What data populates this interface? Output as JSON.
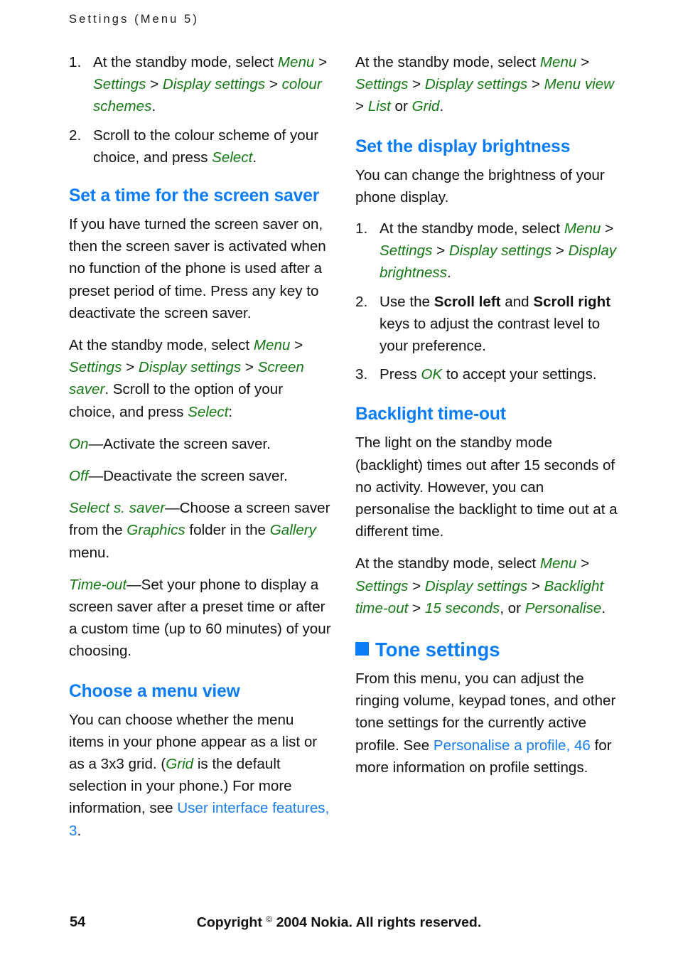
{
  "page": {
    "running_head": "Settings (Menu 5)",
    "folio": "54",
    "copyright_prefix": "Copyright ",
    "copyright_mark": "©",
    "copyright_suffix": " 2004 Nokia. All rights reserved."
  },
  "colors": {
    "heading_blue": "#0b7cf7",
    "link_blue": "#1a7ef0",
    "ui_green": "#157a15",
    "body_black": "#121212",
    "page_background": "#ffffff"
  },
  "left_column": {
    "colour_scheme_steps": [
      {
        "number": "1.",
        "parts": [
          {
            "type": "text",
            "text": "At the standby mode, select "
          },
          {
            "type": "ui",
            "text": "Menu"
          },
          {
            "type": "text",
            "text": " > "
          },
          {
            "type": "ui",
            "text": "Settings"
          },
          {
            "type": "text",
            "text": " > "
          },
          {
            "type": "ui",
            "text": "Display settings"
          },
          {
            "type": "text",
            "text": " > "
          },
          {
            "type": "ui",
            "text": "colour schemes"
          },
          {
            "type": "text",
            "text": "."
          }
        ]
      },
      {
        "number": "2.",
        "parts": [
          {
            "type": "text",
            "text": "Scroll to the colour scheme of your choice, and press "
          },
          {
            "type": "ui",
            "text": "Select"
          },
          {
            "type": "text",
            "text": "."
          }
        ]
      }
    ],
    "screen_saver_heading": "Set a time for the screen saver",
    "screen_saver_intro": "If you have turned the screen saver on, then the screen saver is activated when no function of the phone is used after a preset period of time. Press any key to deactivate the screen saver.",
    "screen_saver_path": [
      {
        "type": "text",
        "text": "At the standby mode, select "
      },
      {
        "type": "ui",
        "text": "Menu"
      },
      {
        "type": "text",
        "text": " > "
      },
      {
        "type": "ui",
        "text": "Settings"
      },
      {
        "type": "text",
        "text": " > "
      },
      {
        "type": "ui",
        "text": "Display settings"
      },
      {
        "type": "text",
        "text": " > "
      },
      {
        "type": "ui",
        "text": "Screen saver"
      },
      {
        "type": "text",
        "text": ". Scroll to the option of your choice, and press "
      },
      {
        "type": "ui",
        "text": "Select"
      },
      {
        "type": "text",
        "text": ":"
      }
    ],
    "option_on": [
      {
        "type": "ui",
        "text": "On"
      },
      {
        "type": "text",
        "text": "—Activate the screen saver."
      }
    ],
    "option_off": [
      {
        "type": "ui",
        "text": "Off"
      },
      {
        "type": "text",
        "text": "—Deactivate the screen saver."
      }
    ],
    "option_select_s_saver": [
      {
        "type": "ui",
        "text": "Select s. saver"
      },
      {
        "type": "text",
        "text": "—Choose a screen saver from the "
      },
      {
        "type": "ui",
        "text": "Graphics"
      },
      {
        "type": "text",
        "text": " folder in the "
      },
      {
        "type": "ui",
        "text": "Gallery"
      },
      {
        "type": "text",
        "text": " menu."
      }
    ],
    "option_time_out": [
      {
        "type": "ui",
        "text": "Time-out"
      },
      {
        "type": "text",
        "text": "—Set your phone to display a screen saver after a preset time or after a custom time (up to 60 minutes) of your choosing."
      }
    ],
    "menu_view_heading": "Choose a menu view",
    "menu_view_body": [
      {
        "type": "text",
        "text": "You can choose whether the menu items in your phone appear as a list or as a 3x3 grid. ("
      },
      {
        "type": "ui",
        "text": "Grid"
      },
      {
        "type": "text",
        "text": " is the default selection in your phone.) For more information, see "
      },
      {
        "type": "link",
        "text": "User interface features, 3"
      },
      {
        "type": "text",
        "text": "."
      }
    ]
  },
  "right_column": {
    "menu_view_path": [
      {
        "type": "text",
        "text": "At the standby mode, select "
      },
      {
        "type": "ui",
        "text": "Menu"
      },
      {
        "type": "text",
        "text": " > "
      },
      {
        "type": "ui",
        "text": "Settings"
      },
      {
        "type": "text",
        "text": " > "
      },
      {
        "type": "ui",
        "text": "Display settings"
      },
      {
        "type": "text",
        "text": " > "
      },
      {
        "type": "ui",
        "text": "Menu view"
      },
      {
        "type": "text",
        "text": " > "
      },
      {
        "type": "ui",
        "text": "List"
      },
      {
        "type": "text",
        "text": " or "
      },
      {
        "type": "ui",
        "text": "Grid"
      },
      {
        "type": "text",
        "text": "."
      }
    ],
    "brightness_heading": "Set the display brightness",
    "brightness_intro": "You can change the brightness of your phone display.",
    "brightness_steps": [
      {
        "number": "1.",
        "parts": [
          {
            "type": "text",
            "text": "At the standby mode, select "
          },
          {
            "type": "ui",
            "text": "Menu"
          },
          {
            "type": "text",
            "text": " > "
          },
          {
            "type": "ui",
            "text": "Settings"
          },
          {
            "type": "text",
            "text": " > "
          },
          {
            "type": "ui",
            "text": "Display settings"
          },
          {
            "type": "text",
            "text": " > "
          },
          {
            "type": "ui",
            "text": "Display brightness"
          },
          {
            "type": "text",
            "text": "."
          }
        ]
      },
      {
        "number": "2.",
        "parts": [
          {
            "type": "text",
            "text": "Use the "
          },
          {
            "type": "bold",
            "text": "Scroll left"
          },
          {
            "type": "text",
            "text": " and "
          },
          {
            "type": "bold",
            "text": "Scroll right"
          },
          {
            "type": "text",
            "text": " keys to adjust the contrast level to your preference."
          }
        ]
      },
      {
        "number": "3.",
        "parts": [
          {
            "type": "text",
            "text": "Press "
          },
          {
            "type": "ui",
            "text": "OK"
          },
          {
            "type": "text",
            "text": " to accept your settings."
          }
        ]
      }
    ],
    "backlight_heading": "Backlight time-out",
    "backlight_intro": "The light on the standby mode (backlight) times out after 15 seconds of no activity. However, you can personalise the backlight to time out at a different time.",
    "backlight_path": [
      {
        "type": "text",
        "text": "At the standby mode, select "
      },
      {
        "type": "ui",
        "text": "Menu"
      },
      {
        "type": "text",
        "text": " > "
      },
      {
        "type": "ui",
        "text": "Settings"
      },
      {
        "type": "text",
        "text": " > "
      },
      {
        "type": "ui",
        "text": "Display settings"
      },
      {
        "type": "text",
        "text": " > "
      },
      {
        "type": "ui",
        "text": "Backlight time-out"
      },
      {
        "type": "text",
        "text": " > "
      },
      {
        "type": "ui",
        "text": "15 seconds"
      },
      {
        "type": "text",
        "text": ", or "
      },
      {
        "type": "ui",
        "text": "Personalise"
      },
      {
        "type": "text",
        "text": "."
      }
    ],
    "tone_settings_heading": "Tone settings",
    "tone_settings_body": [
      {
        "type": "text",
        "text": "From this menu, you can adjust the ringing volume, keypad tones, and other tone settings for the currently active profile. See "
      },
      {
        "type": "link",
        "text": "Personalise a profile, 46"
      },
      {
        "type": "text",
        "text": " for more information on profile settings."
      }
    ]
  }
}
